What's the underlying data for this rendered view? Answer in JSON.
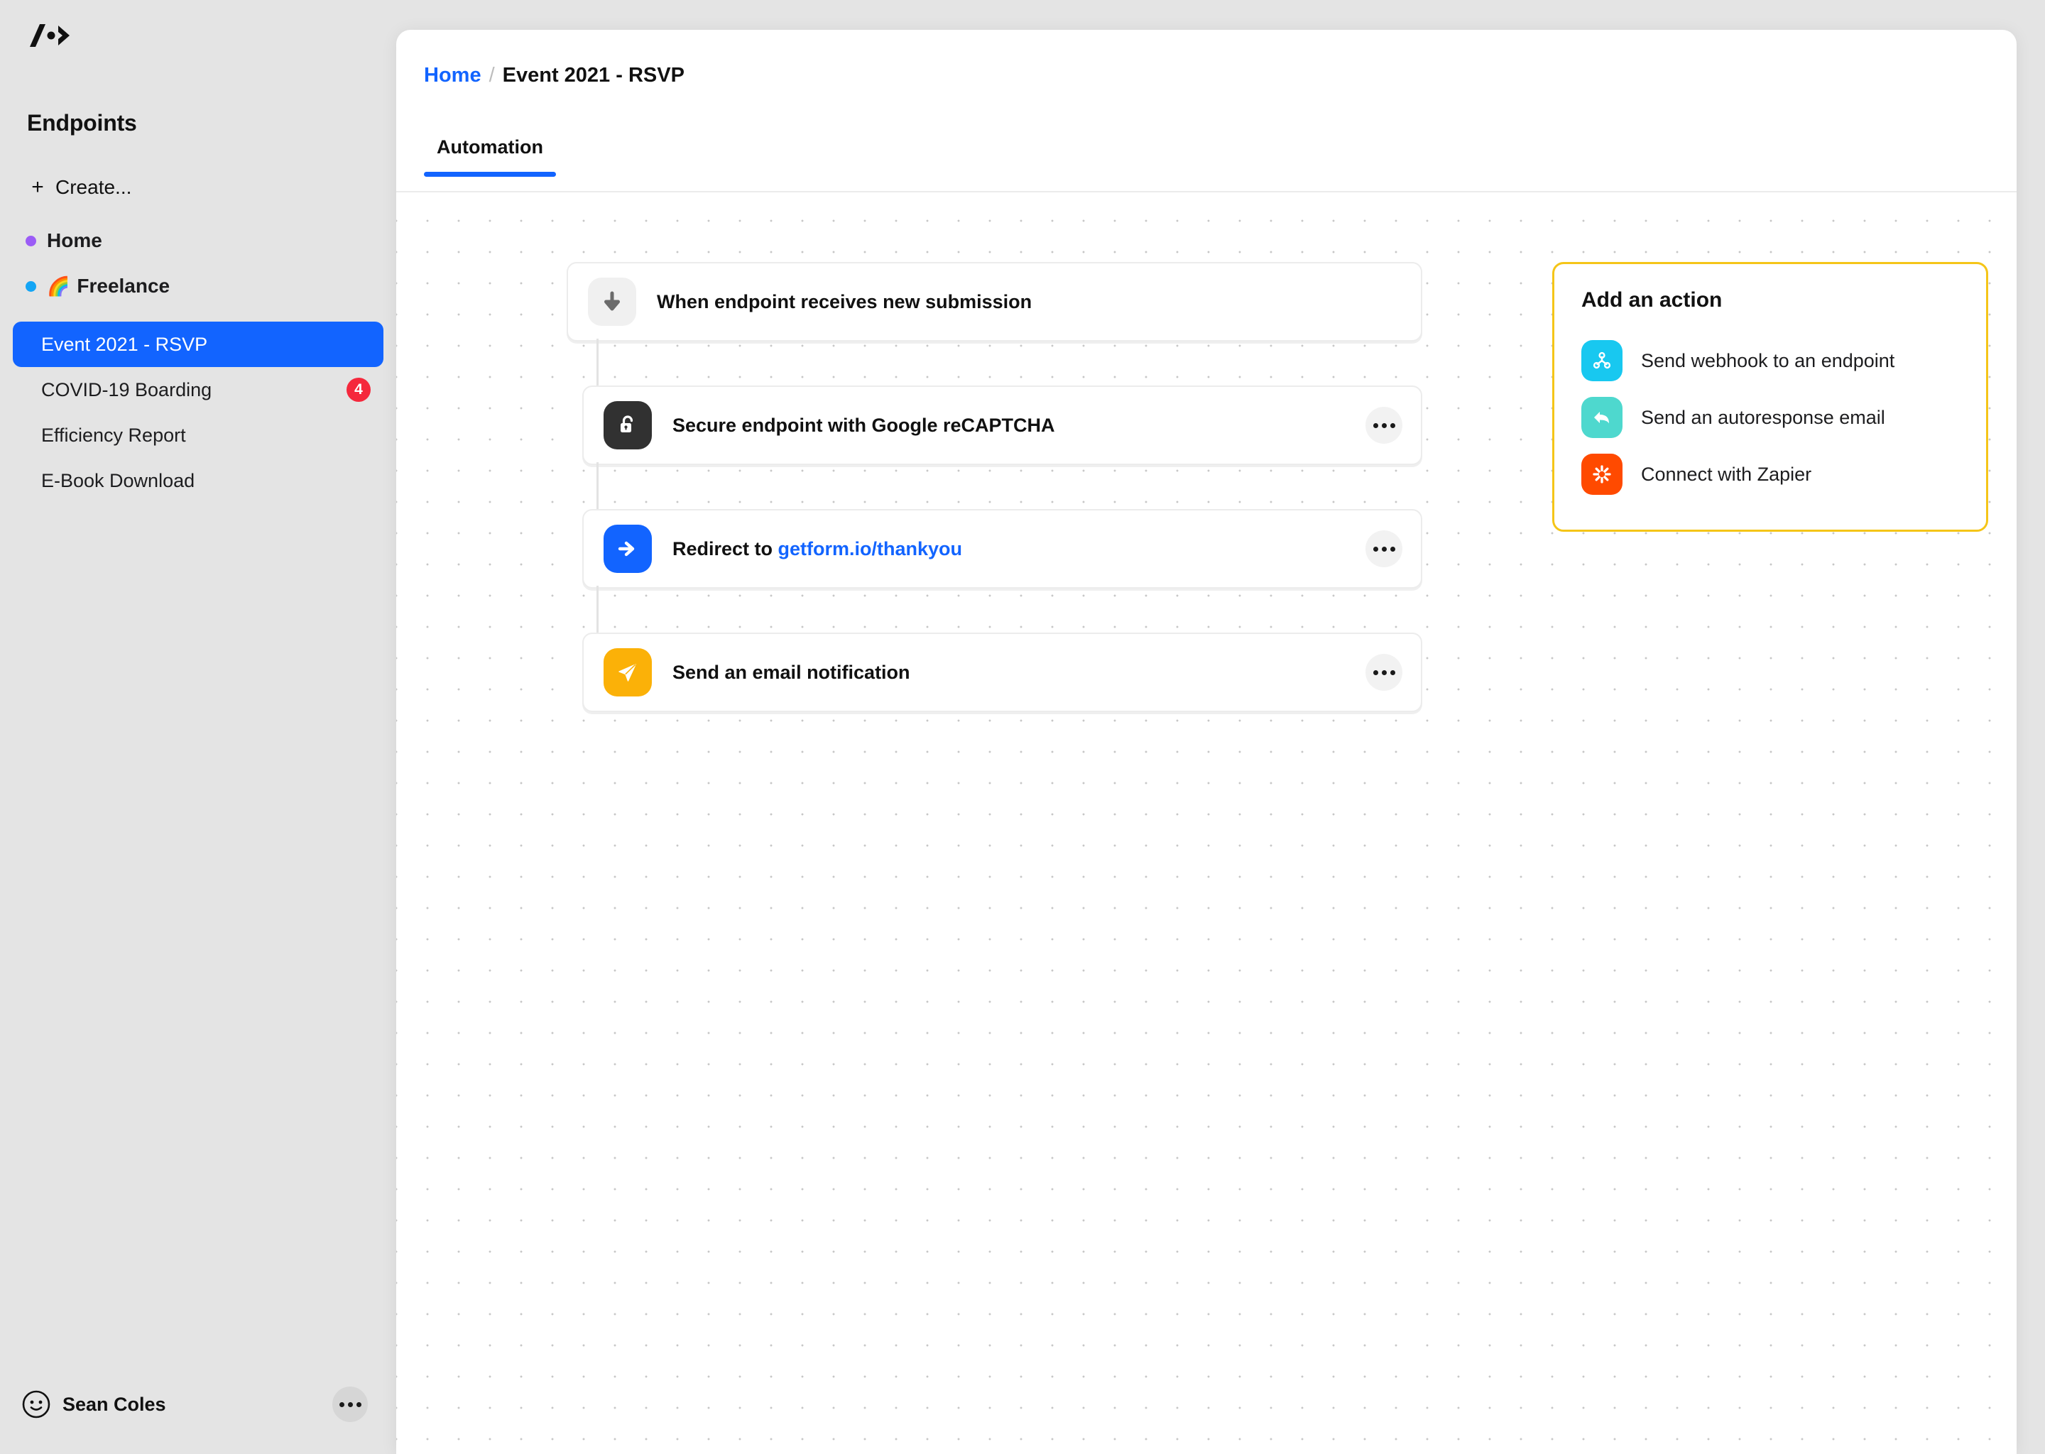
{
  "app": {
    "logo_name": "getform-logo",
    "accent_blue": "#1264ff",
    "badge_red": "#f5283c",
    "panel_border_yellow": "#f5c518"
  },
  "sidebar": {
    "title": "Endpoints",
    "create_label": "Create...",
    "items": [
      {
        "label": "Home",
        "type": "group",
        "dot_color": "#9b5cf6",
        "emoji": "",
        "active": false,
        "badge": ""
      },
      {
        "label": "Freelance",
        "type": "group",
        "dot_color": "#14a5f5",
        "emoji": "🌈",
        "active": false,
        "badge": ""
      },
      {
        "label": "Event 2021 - RSVP",
        "type": "child",
        "dot_color": "",
        "emoji": "",
        "active": true,
        "badge": ""
      },
      {
        "label": "COVID-19 Boarding",
        "type": "child",
        "dot_color": "",
        "emoji": "",
        "active": false,
        "badge": "4"
      },
      {
        "label": "Efficiency Report",
        "type": "child",
        "dot_color": "",
        "emoji": "",
        "active": false,
        "badge": ""
      },
      {
        "label": "E-Book Download",
        "type": "child",
        "dot_color": "",
        "emoji": "",
        "active": false,
        "badge": ""
      }
    ],
    "user": {
      "name": "Sean Coles",
      "avatar_icon": "smiley-face-icon",
      "menu_icon": "more-horizontal-icon"
    }
  },
  "header": {
    "breadcrumb_home": "Home",
    "breadcrumb_separator": "/",
    "breadcrumb_current": "Event 2021 - RSVP",
    "tabs": [
      {
        "label": "Automation",
        "active": true
      }
    ]
  },
  "flow": {
    "nodes": [
      {
        "label": "When endpoint receives new submission",
        "link_text": "",
        "icon_name": "arrow-down-icon",
        "icon_bg": "#f0f0f0",
        "icon_fg": "#6b6b6b",
        "kind": "trigger",
        "has_menu": false
      },
      {
        "label": "Secure endpoint with Google reCAPTCHA",
        "link_text": "",
        "icon_name": "unlocked-padlock-icon",
        "icon_bg": "#313131",
        "icon_fg": "#ffffff",
        "kind": "step",
        "has_menu": true
      },
      {
        "label": "Redirect to ",
        "link_text": "getform.io/thankyou",
        "icon_name": "arrow-right-icon",
        "icon_bg": "#1264ff",
        "icon_fg": "#ffffff",
        "kind": "step",
        "has_menu": true
      },
      {
        "label": "Send an email notification",
        "link_text": "",
        "icon_name": "paper-plane-icon",
        "icon_bg": "#fbb108",
        "icon_fg": "#ffffff",
        "kind": "step",
        "has_menu": true
      }
    ]
  },
  "add_action": {
    "title": "Add an action",
    "options": [
      {
        "label": "Send webhook to an endpoint",
        "icon_name": "webhook-node-icon",
        "icon_bg": "#18c8f0"
      },
      {
        "label": "Send an autoresponse email",
        "icon_name": "reply-arrow-icon",
        "icon_bg": "#4ed8ce"
      },
      {
        "label": "Connect with Zapier",
        "icon_name": "zapier-asterisk-icon",
        "icon_bg": "#ff4a00"
      }
    ]
  }
}
